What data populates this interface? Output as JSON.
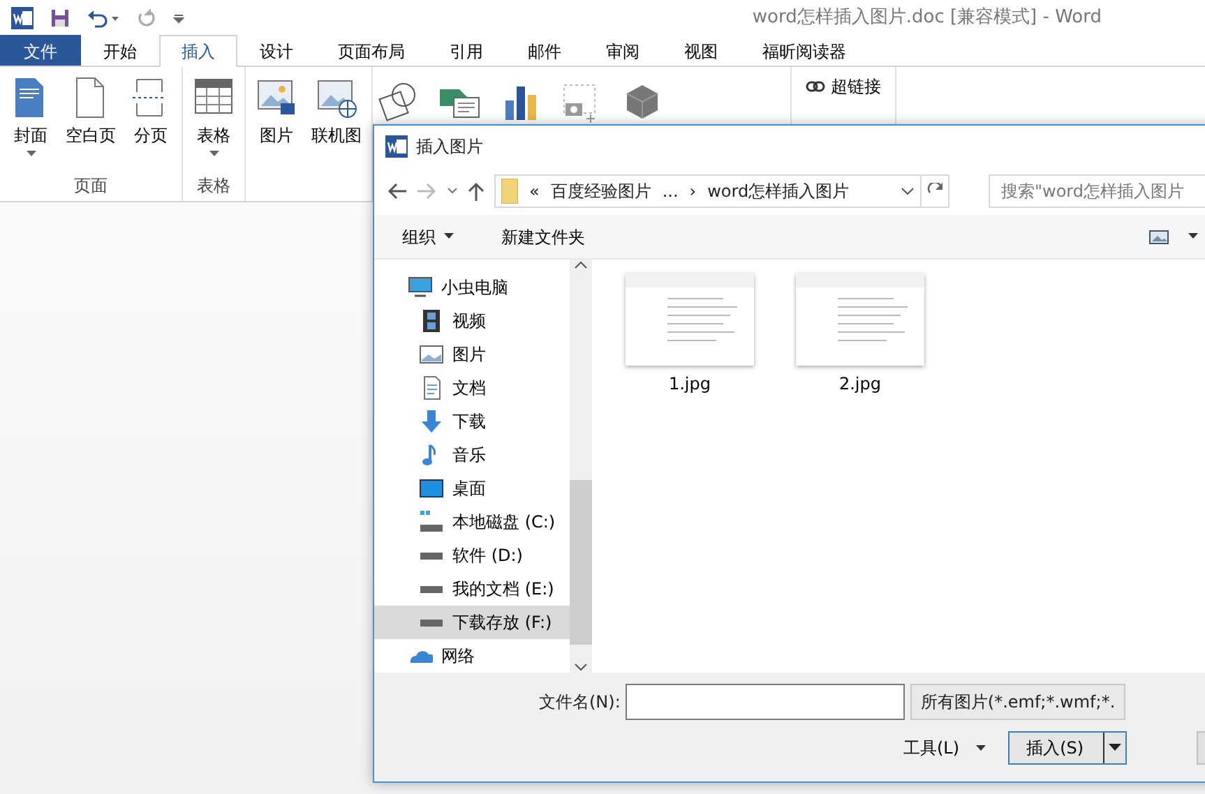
{
  "window": {
    "title": "word怎样插入图片.doc [兼容模式] - Word"
  },
  "tabs": [
    {
      "label": "文件",
      "kind": "file",
      "selected": false
    },
    {
      "label": "开始",
      "kind": "tab",
      "selected": false
    },
    {
      "label": "插入",
      "kind": "tab",
      "selected": true
    },
    {
      "label": "设计",
      "kind": "tab",
      "selected": false
    },
    {
      "label": "页面布局",
      "kind": "tab",
      "selected": false
    },
    {
      "label": "引用",
      "kind": "tab",
      "selected": false
    },
    {
      "label": "邮件",
      "kind": "tab",
      "selected": false
    },
    {
      "label": "审阅",
      "kind": "tab",
      "selected": false
    },
    {
      "label": "视图",
      "kind": "tab",
      "selected": false
    },
    {
      "label": "福昕阅读器",
      "kind": "tab",
      "selected": false
    }
  ],
  "ribbon": {
    "groups": [
      {
        "label": "页面",
        "buttons": [
          {
            "label": "封面",
            "kind": "cover",
            "dropdown": true
          },
          {
            "label": "空白页",
            "kind": "blank",
            "dropdown": false
          },
          {
            "label": "分页",
            "kind": "break",
            "dropdown": false
          }
        ]
      },
      {
        "label": "表格",
        "buttons": [
          {
            "label": "表格",
            "kind": "table",
            "dropdown": true
          }
        ]
      },
      {
        "buttons": [
          {
            "label": "图片",
            "kind": "picture",
            "dropdown": false
          },
          {
            "label": "联机图",
            "kind": "online",
            "dropdown": false
          }
        ]
      }
    ],
    "links": [
      {
        "label": "超链接"
      }
    ]
  },
  "dialog": {
    "title": "插入图片",
    "address": [
      "«",
      "百度经验图片",
      "...",
      "›",
      "word怎样插入图片"
    ],
    "search": {
      "placeholder": "搜索\"word怎样插入图片"
    },
    "toolbar": {
      "organize": "组织",
      "new_folder": "新建文件夹"
    },
    "nav": [
      {
        "label": "小虫电脑",
        "kind": "computer",
        "selected": false,
        "children": [
          {
            "label": "视频",
            "kind": "video",
            "selected": false
          },
          {
            "label": "图片",
            "kind": "pictures",
            "selected": false
          },
          {
            "label": "文档",
            "kind": "documents",
            "selected": false
          },
          {
            "label": "下载",
            "kind": "downloads",
            "selected": false
          },
          {
            "label": "音乐",
            "kind": "music",
            "selected": false
          },
          {
            "label": "桌面",
            "kind": "desktop",
            "selected": false
          },
          {
            "label": "本地磁盘 (C:)",
            "kind": "system-drive",
            "selected": false
          },
          {
            "label": "软件 (D:)",
            "kind": "drive",
            "selected": false
          },
          {
            "label": "我的文档 (E:)",
            "kind": "drive",
            "selected": false
          },
          {
            "label": "下载存放 (F:)",
            "kind": "drive",
            "selected": true
          }
        ]
      },
      {
        "label": "网络",
        "kind": "network",
        "selected": false
      }
    ],
    "files": [
      {
        "name": "1.jpg"
      },
      {
        "name": "2.jpg"
      }
    ],
    "filename": {
      "label": "文件名(N):"
    },
    "filter": "所有图片(*.emf;*.wmf;*.",
    "tools": "工具(L)",
    "insert": "插入(S)"
  }
}
